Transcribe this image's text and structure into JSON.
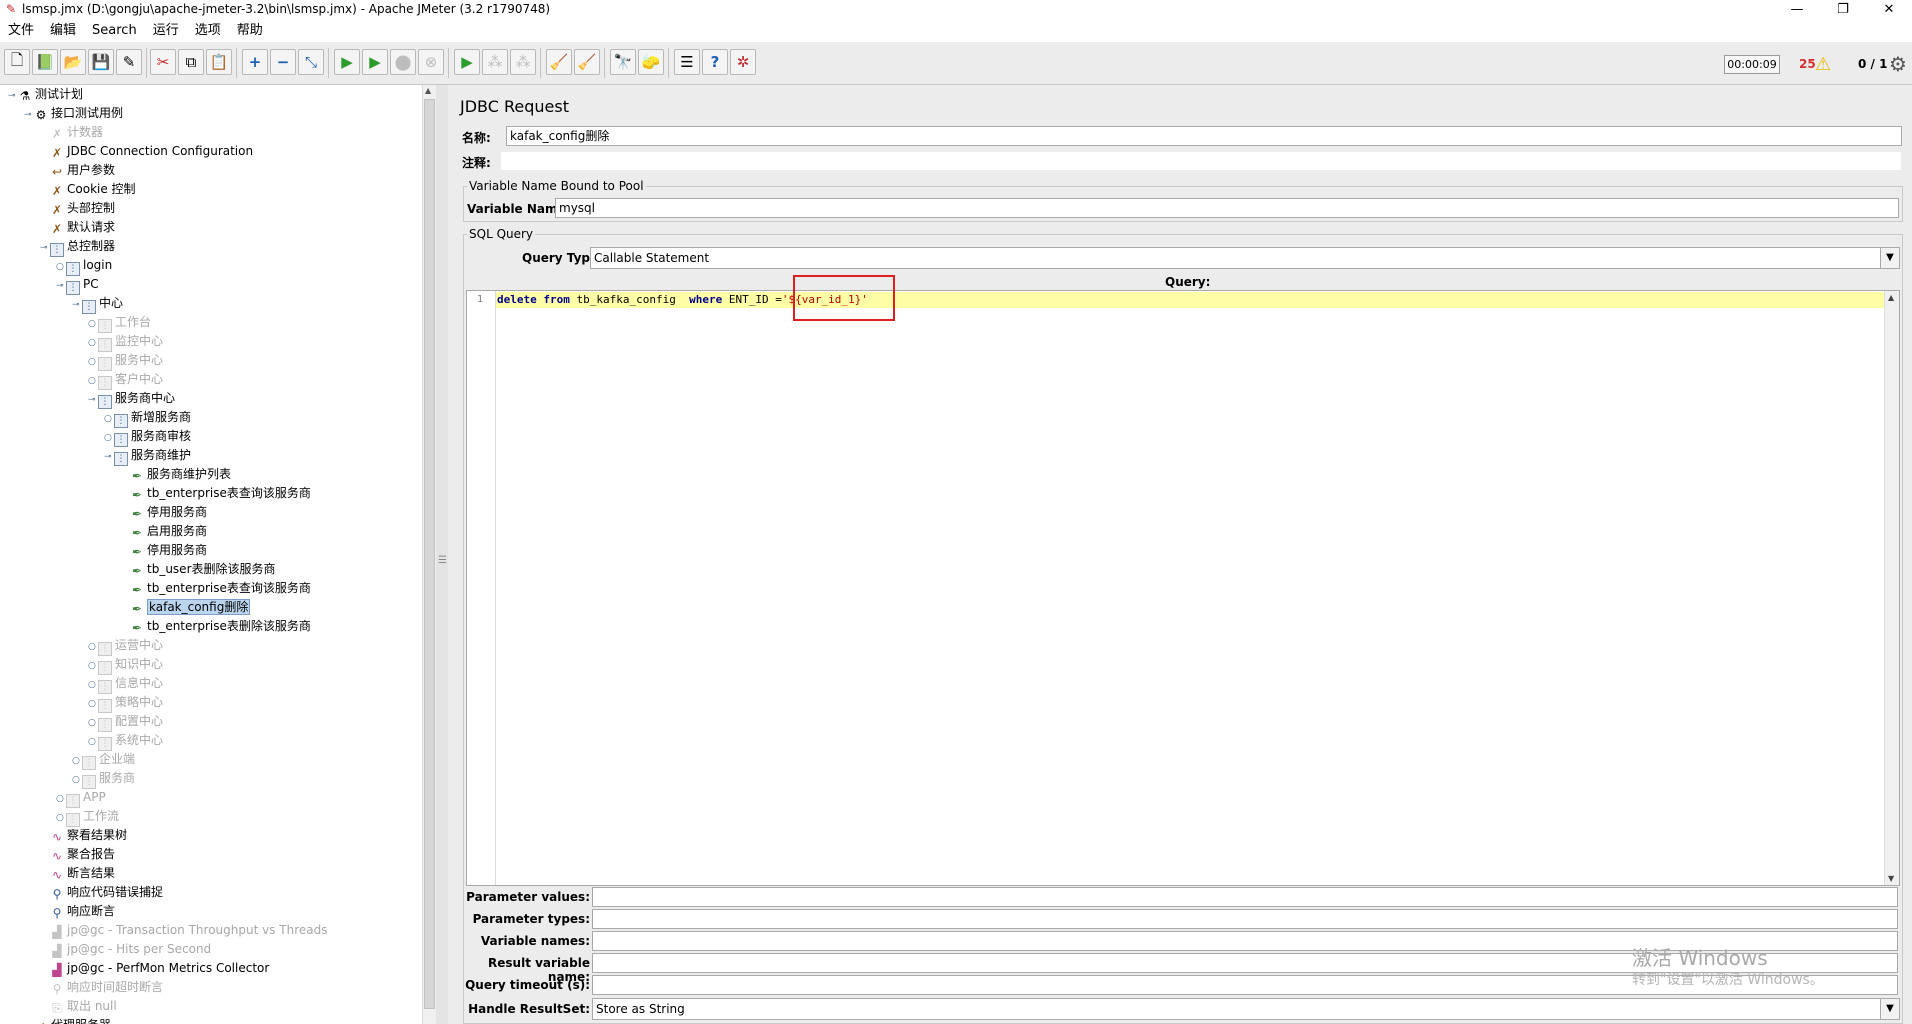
{
  "window": {
    "title": "lsmsp.jmx (D:\\gongju\\apache-jmeter-3.2\\bin\\lsmsp.jmx) - Apache JMeter (3.2 r1790748)",
    "min": "—",
    "max": "❐",
    "close": "✕"
  },
  "menu": [
    "文件",
    "编辑",
    "Search",
    "运行",
    "选项",
    "帮助"
  ],
  "status": {
    "timer": "00:00:09",
    "errors": "25",
    "threads": "0 / 1"
  },
  "tree": [
    {
      "label": "测试计划",
      "icon": "flask-icon",
      "depth": 0,
      "tog": "expanded",
      "kind": "plan",
      "disabled": false
    },
    {
      "label": "接口测试用例",
      "icon": "gear-icon",
      "depth": 1,
      "tog": "expanded",
      "kind": "thread",
      "disabled": false
    },
    {
      "label": "计数器",
      "icon": "tools-icon",
      "depth": 2,
      "tog": "",
      "kind": "tool",
      "disabled": true
    },
    {
      "label": "JDBC Connection Configuration",
      "icon": "tools-icon",
      "depth": 2,
      "tog": "",
      "kind": "tool",
      "disabled": false
    },
    {
      "label": "用户参数",
      "icon": "preprocessor-icon",
      "depth": 2,
      "tog": "",
      "kind": "tool",
      "disabled": false
    },
    {
      "label": "Cookie 控制",
      "icon": "tools-icon",
      "depth": 2,
      "tog": "",
      "kind": "tool",
      "disabled": false
    },
    {
      "label": "头部控制",
      "icon": "tools-icon",
      "depth": 2,
      "tog": "",
      "kind": "tool",
      "disabled": false
    },
    {
      "label": "默认请求",
      "icon": "tools-icon",
      "depth": 2,
      "tog": "",
      "kind": "tool",
      "disabled": false
    },
    {
      "label": "总控制器",
      "icon": "controller-icon",
      "depth": 2,
      "tog": "expanded",
      "kind": "ctl",
      "disabled": false
    },
    {
      "label": "login",
      "icon": "controller-icon",
      "depth": 3,
      "tog": "collapsed",
      "kind": "ctl",
      "disabled": false
    },
    {
      "label": "PC",
      "icon": "controller-icon",
      "depth": 3,
      "tog": "expanded",
      "kind": "ctl",
      "disabled": false
    },
    {
      "label": "中心",
      "icon": "controller-icon",
      "depth": 4,
      "tog": "expanded",
      "kind": "ctl",
      "disabled": false
    },
    {
      "label": "工作台",
      "icon": "controller-icon",
      "depth": 5,
      "tog": "collapsed",
      "kind": "ctl",
      "disabled": true
    },
    {
      "label": "监控中心",
      "icon": "controller-icon",
      "depth": 5,
      "tog": "collapsed",
      "kind": "ctl",
      "disabled": true
    },
    {
      "label": "服务中心",
      "icon": "controller-icon",
      "depth": 5,
      "tog": "collapsed",
      "kind": "ctl",
      "disabled": true
    },
    {
      "label": "客户中心",
      "icon": "controller-icon",
      "depth": 5,
      "tog": "collapsed",
      "kind": "ctl",
      "disabled": true
    },
    {
      "label": "服务商中心",
      "icon": "controller-icon",
      "depth": 5,
      "tog": "expanded",
      "kind": "ctl",
      "disabled": false
    },
    {
      "label": "新增服务商",
      "icon": "controller-icon",
      "depth": 6,
      "tog": "collapsed",
      "kind": "ctl",
      "disabled": false
    },
    {
      "label": "服务商审核",
      "icon": "controller-icon",
      "depth": 6,
      "tog": "collapsed",
      "kind": "ctl",
      "disabled": false
    },
    {
      "label": "服务商维护",
      "icon": "controller-icon",
      "depth": 6,
      "tog": "expanded",
      "kind": "ctl",
      "disabled": false
    },
    {
      "label": "服务商维护列表",
      "icon": "pipette-icon",
      "depth": 7,
      "tog": "",
      "kind": "sampler",
      "disabled": false
    },
    {
      "label": "tb_enterprise表查询该服务商",
      "icon": "pipette-icon",
      "depth": 7,
      "tog": "",
      "kind": "sampler",
      "disabled": false
    },
    {
      "label": "停用服务商",
      "icon": "pipette-icon",
      "depth": 7,
      "tog": "",
      "kind": "sampler",
      "disabled": false
    },
    {
      "label": "启用服务商",
      "icon": "pipette-icon",
      "depth": 7,
      "tog": "",
      "kind": "sampler",
      "disabled": false
    },
    {
      "label": "停用服务商",
      "icon": "pipette-icon",
      "depth": 7,
      "tog": "",
      "kind": "sampler",
      "disabled": false
    },
    {
      "label": "tb_user表删除该服务商",
      "icon": "pipette-icon",
      "depth": 7,
      "tog": "",
      "kind": "sampler",
      "disabled": false
    },
    {
      "label": "tb_enterprise表查询该服务商",
      "icon": "pipette-icon",
      "depth": 7,
      "tog": "",
      "kind": "sampler",
      "disabled": false
    },
    {
      "label": "kafak_config删除",
      "icon": "pipette-icon",
      "depth": 7,
      "tog": "",
      "kind": "sampler",
      "disabled": false,
      "selected": true
    },
    {
      "label": "tb_enterprise表删除该服务商",
      "icon": "pipette-icon",
      "depth": 7,
      "tog": "",
      "kind": "sampler",
      "disabled": false
    },
    {
      "label": "运营中心",
      "icon": "controller-icon",
      "depth": 5,
      "tog": "collapsed",
      "kind": "ctl",
      "disabled": true
    },
    {
      "label": "知识中心",
      "icon": "controller-icon",
      "depth": 5,
      "tog": "collapsed",
      "kind": "ctl",
      "disabled": true
    },
    {
      "label": "信息中心",
      "icon": "controller-icon",
      "depth": 5,
      "tog": "collapsed",
      "kind": "ctl",
      "disabled": true
    },
    {
      "label": "策略中心",
      "icon": "controller-icon",
      "depth": 5,
      "tog": "collapsed",
      "kind": "ctl",
      "disabled": true
    },
    {
      "label": "配置中心",
      "icon": "controller-icon",
      "depth": 5,
      "tog": "collapsed",
      "kind": "ctl",
      "disabled": true
    },
    {
      "label": "系统中心",
      "icon": "controller-icon",
      "depth": 5,
      "tog": "collapsed",
      "kind": "ctl",
      "disabled": true
    },
    {
      "label": "企业端",
      "icon": "controller-icon",
      "depth": 4,
      "tog": "collapsed",
      "kind": "ctl",
      "disabled": true
    },
    {
      "label": "服务商",
      "icon": "controller-icon",
      "depth": 4,
      "tog": "collapsed",
      "kind": "ctl",
      "disabled": true
    },
    {
      "label": "APP",
      "icon": "controller-icon",
      "depth": 3,
      "tog": "collapsed",
      "kind": "ctl",
      "disabled": true
    },
    {
      "label": "工作流",
      "icon": "controller-icon",
      "depth": 3,
      "tog": "collapsed",
      "kind": "ctl",
      "disabled": true
    },
    {
      "label": "察看结果树",
      "icon": "graph-icon",
      "depth": 2,
      "tog": "",
      "kind": "listener",
      "disabled": false
    },
    {
      "label": "聚合报告",
      "icon": "graph-icon",
      "depth": 2,
      "tog": "",
      "kind": "listener",
      "disabled": false
    },
    {
      "label": "断言结果",
      "icon": "graph-icon",
      "depth": 2,
      "tog": "",
      "kind": "listener",
      "disabled": false
    },
    {
      "label": "响应代码错误捕捉",
      "icon": "magnifier-icon",
      "depth": 2,
      "tog": "",
      "kind": "assert",
      "disabled": false
    },
    {
      "label": "响应断言",
      "icon": "magnifier-icon",
      "depth": 2,
      "tog": "",
      "kind": "assert",
      "disabled": false
    },
    {
      "label": "jp@gc - Transaction Throughput vs Threads",
      "icon": "chart-icon",
      "depth": 2,
      "tog": "",
      "kind": "listener",
      "disabled": true
    },
    {
      "label": "jp@gc - Hits per Second",
      "icon": "chart-icon",
      "depth": 2,
      "tog": "",
      "kind": "listener",
      "disabled": true
    },
    {
      "label": "jp@gc - PerfMon Metrics Collector",
      "icon": "chart-icon",
      "depth": 2,
      "tog": "",
      "kind": "listener",
      "disabled": false
    },
    {
      "label": "响应时间超时断言",
      "icon": "magnifier-icon",
      "depth": 2,
      "tog": "",
      "kind": "assert",
      "disabled": true
    },
    {
      "label": "取出 null",
      "icon": "extractor-icon",
      "depth": 2,
      "tog": "",
      "kind": "assert",
      "disabled": true
    },
    {
      "label": "代理服务器",
      "icon": "proxy-icon",
      "depth": 1,
      "tog": "",
      "kind": "tool",
      "disabled": false
    }
  ],
  "panel": {
    "title": "JDBC Request",
    "name_label": "名称:",
    "name_value": "kafak_config删除",
    "comment_label": "注释:",
    "comment_value": "",
    "pool_group": "Variable Name Bound to Pool",
    "varname_label": "Variable Name:",
    "varname_value": "mysql",
    "sql_group": "SQL Query",
    "querytype_label": "Query Type:",
    "querytype_value": "Callable Statement",
    "query_label": "Query:",
    "line_no": "1",
    "code": {
      "kw1": "delete",
      "kw2": "from",
      "table": " tb_kafka_config  ",
      "kw3": "where",
      "cond": " ENT_ID =",
      "str": "'${var_id_1}'"
    },
    "params": [
      {
        "label": "Parameter values:",
        "value": ""
      },
      {
        "label": "Parameter types:",
        "value": ""
      },
      {
        "label": "Variable names:",
        "value": ""
      },
      {
        "label": "Result variable name:",
        "value": ""
      },
      {
        "label": "Query timeout (s):",
        "value": ""
      }
    ],
    "resultset_label": "Handle ResultSet:",
    "resultset_value": "Store as String"
  },
  "watermark": {
    "line1": "激活 Windows",
    "line2": "转到\"设置\"以激活 Windows。"
  },
  "colors": {
    "selection": "#bcd5ee",
    "highlight_box": "#e02020",
    "current_line": "#ffffa8",
    "error_count": "#d32f2f"
  }
}
